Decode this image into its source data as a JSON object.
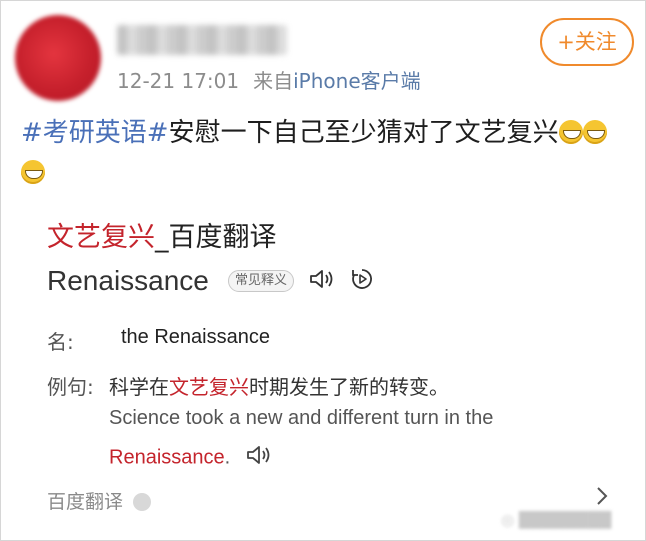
{
  "post": {
    "time": "12-21 17:01",
    "source_prefix": "来自",
    "source": "iPhone客户端",
    "follow_label": "+关注",
    "hashtag": "#考研英语#",
    "text": "安慰一下自己至少猜对了文艺复兴",
    "emoji": "grinning-face"
  },
  "card": {
    "title_highlight": "文艺复兴",
    "title_rest": "_百度翻译",
    "word": "Renaissance",
    "badge": "常见释义",
    "name_label": "名:",
    "name_value": "the Renaissance",
    "example_label": "例句:",
    "example_cn_pre": "科学在",
    "example_cn_hl": "文艺复兴",
    "example_cn_post": "时期发生了新的转变。",
    "example_en_line1": "Science took a new and different turn in the",
    "example_en_hl": "Renaissance",
    "example_en_end": ".",
    "footer": "百度翻译"
  },
  "colors": {
    "accent_orange": "#f08a2c",
    "hashtag_blue": "#4a70b8",
    "highlight_red": "#c4242c"
  }
}
